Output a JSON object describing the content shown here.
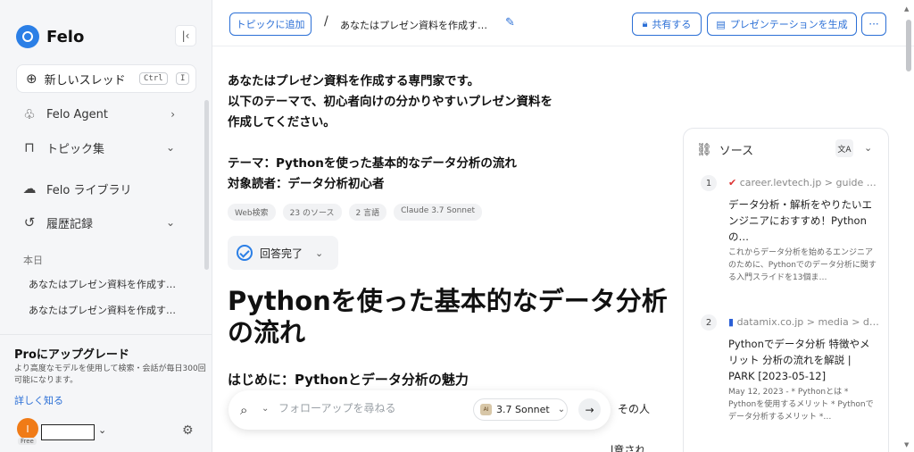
{
  "sidebar": {
    "brand": "Felo",
    "collapse_icon": "collapse-left-icon",
    "new_thread": {
      "label": "新しいスレッド",
      "kbd1": "Ctrl",
      "kbd2": "I"
    },
    "nav": [
      {
        "label": "Felo Agent",
        "icon": "agent-icon"
      },
      {
        "label": "トピック集",
        "icon": "bookmark-icon"
      },
      {
        "label": "Felo ライブラリ",
        "icon": "cloud-upload-icon"
      },
      {
        "label": "履歴記録",
        "icon": "history-icon"
      }
    ],
    "today_label": "本日",
    "history": [
      "あなたはプレゼン資料を作成す…",
      "あなたはプレゼン資料を作成す…"
    ],
    "pro": {
      "title": "Proにアップグレード",
      "desc": "より高度なモデルを使用して検索・会話が毎日300回可能になります。",
      "learn_more": "詳しく知る"
    },
    "user": {
      "initial": "I",
      "plan": "Free"
    }
  },
  "header": {
    "topic_button": "トピックに追加",
    "separator": "/",
    "doc_title": "あなたはプレゼン資料を作成す…",
    "share_button": "共有する",
    "present_button": "プレゼンテーションを生成",
    "more_button": "···"
  },
  "main": {
    "question_lines": [
      "あなたはプレゼン資料を作成する専門家です。",
      "以下のテーマで、初心者向けの分かりやすいプレゼン資料を",
      "作成してください。",
      "",
      "テーマ：Pythonを使った基本的なデータ分析の流れ",
      "対象読者：データ分析初心者"
    ],
    "tags": [
      "Web検索",
      "23 のソース",
      "2 言語",
      "Claude 3.7 Sonnet"
    ],
    "status": "回答完了",
    "heading": "Pythonを使った基本的なデータ分析の流れ",
    "subheading": "はじめに：Pythonとデータ分析の魅力",
    "followup": {
      "placeholder": "フォローアップを尋ねる",
      "model": "3.7 Sonnet",
      "model_logo": "AI"
    },
    "peek1": "その人",
    "peek2": "l意され"
  },
  "sources": {
    "title": "ソース",
    "translate_label": "文A",
    "items": [
      {
        "num": "1",
        "domain": "career.levtech.jp > guide …",
        "title": "データ分析・解析をやりたいエンジニアにおすすめ！Pythonの…",
        "snippet": "これからデータ分析を始めるエンジニアのために、Pythonでのデータ分析に関する入門スライドを13個ま…"
      },
      {
        "num": "2",
        "domain": "datamix.co.jp > media > d…",
        "title": "Pythonでデータ分析 特徴やメリット 分析の流れを解説 | PARK [2023-05-12]",
        "snippet": "May 12, 2023 - * Pythonとは * Pythonを使用するメリット * Pythonでデータ分析するメリット *…"
      }
    ]
  }
}
